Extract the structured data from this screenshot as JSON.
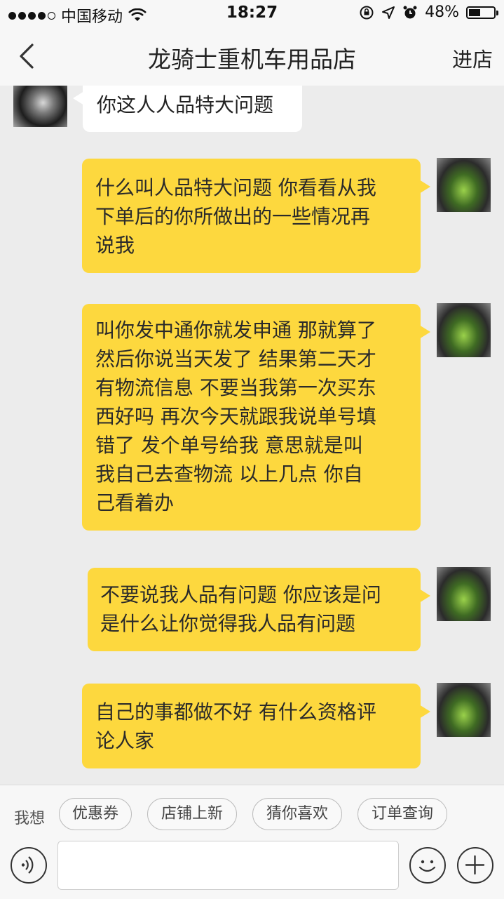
{
  "status_bar": {
    "carrier": "中国移动",
    "time": "18:27",
    "battery": "48%",
    "battery_level": 0.48,
    "icons": [
      "signal-dots-icon",
      "wifi-icon",
      "orientation-lock-icon",
      "location-icon",
      "alarm-icon",
      "battery-icon"
    ]
  },
  "nav": {
    "back_icon": "chevron-left-icon",
    "title": "龙骑士重机车用品店",
    "right_action": "进店"
  },
  "messages": [
    {
      "sender": "store",
      "avatar": "store-avatar",
      "lines": [
        "你这人人品特大问题"
      ]
    },
    {
      "sender": "me",
      "avatar": "user-avatar",
      "lines": [
        "什么叫人品特大问题  你看看从我",
        "下单后的你所做出的一些情况再",
        "说我"
      ]
    },
    {
      "sender": "me",
      "avatar": "user-avatar",
      "lines": [
        "叫你发中通你就发申通  那就算了",
        "然后你说当天发了  结果第二天才",
        "有物流信息  不要当我第一次买东",
        "西好吗  再次今天就跟我说单号填",
        "错了  发个单号给我  意思就是叫",
        "我自己去查物流  以上几点  你自",
        "己看着办"
      ]
    },
    {
      "sender": "me",
      "avatar": "user-avatar",
      "lines": [
        "不要说我人品有问题 你应该是问",
        "是什么让你觉得我人品有问题"
      ]
    },
    {
      "sender": "me",
      "avatar": "user-avatar",
      "lines": [
        "自己的事都做不好  有什么资格评",
        "论人家"
      ]
    }
  ],
  "quick_replies": {
    "label": "我想",
    "chips": [
      "优惠券",
      "店铺上新",
      "猜你喜欢",
      "订单查询"
    ]
  },
  "input_bar": {
    "voice_icon": "voice-icon",
    "emoji_icon": "emoji-icon",
    "add_icon": "plus-icon",
    "value": ""
  },
  "colors": {
    "my_bubble": "#fdd83e",
    "their_bubble": "#ffffff",
    "background": "#ececec"
  }
}
